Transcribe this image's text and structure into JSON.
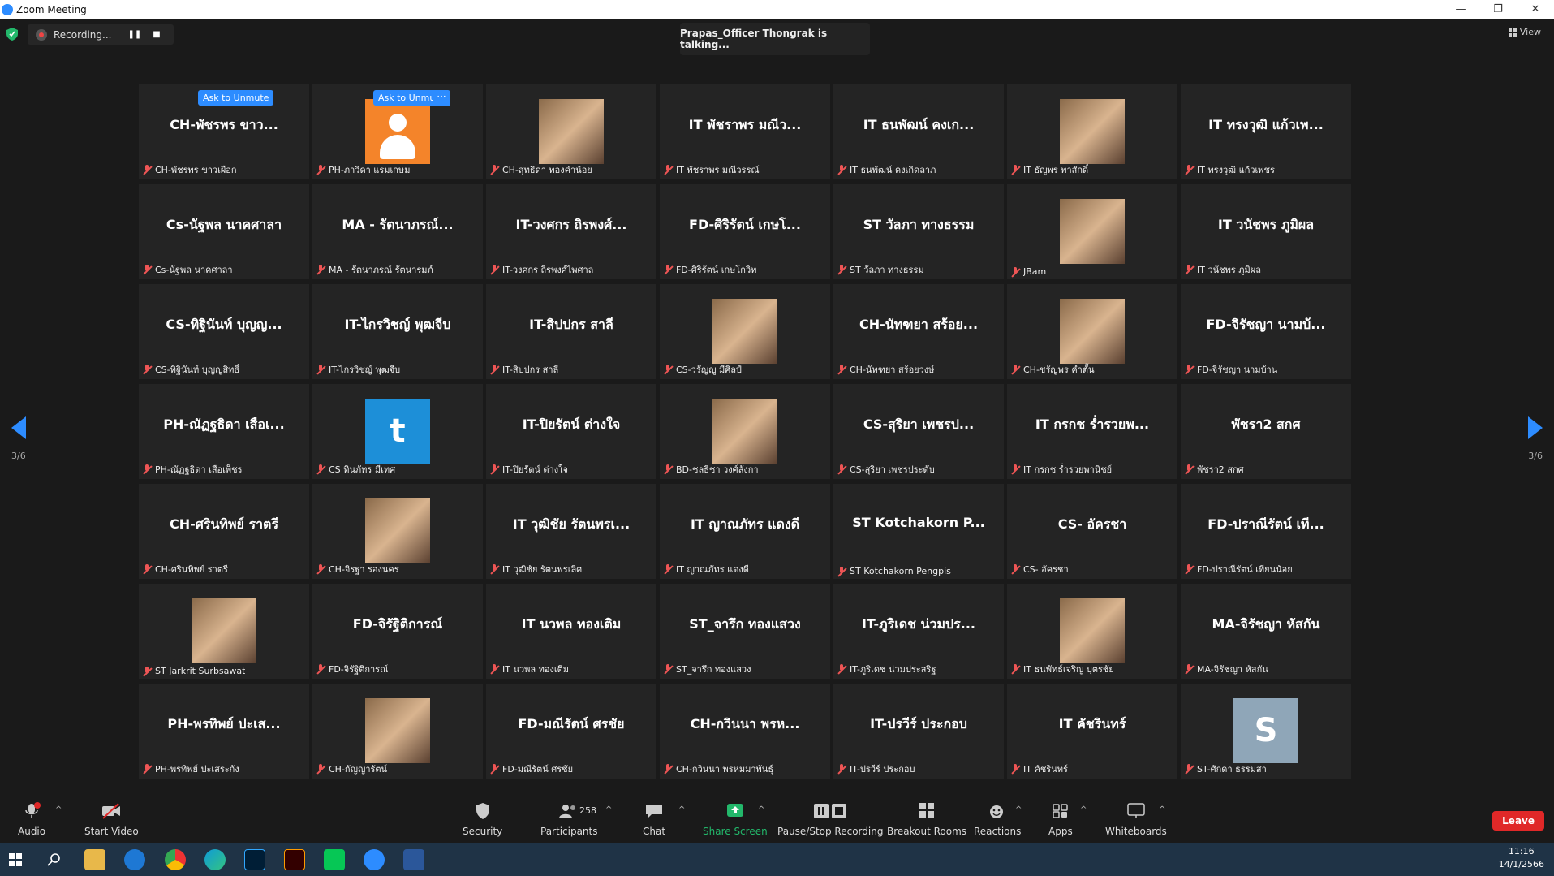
{
  "window": {
    "title": "Zoom Meeting",
    "minimize": "—",
    "restore": "❐",
    "close": "✕"
  },
  "topbar": {
    "recording_label": "Recording...",
    "talking_text": "Prapas_Officer Thongrak is talking...",
    "view_label": "View"
  },
  "pagination": {
    "left": "3/6",
    "right": "3/6"
  },
  "overlay": {
    "ask_to_unmute": "Ask to Unmute",
    "more": "···"
  },
  "participants": [
    {
      "big": "CH-พัชรพร ขาว...",
      "name": "CH-พัชรพร ขาวเผือก",
      "type": "name",
      "unmute": true
    },
    {
      "big": "",
      "name": "PH-ภาวิดา แรมเกษม",
      "type": "person",
      "unmute": true,
      "more": true
    },
    {
      "big": "",
      "name": "CH-สุทธิดา ทองคำน้อย",
      "type": "photo"
    },
    {
      "big": "IT พัชราพร มณีว...",
      "name": "IT พัชราพร มณีวรรณ์",
      "type": "name"
    },
    {
      "big": "IT ธนพัฒน์ คงเก...",
      "name": "IT ธนพัฒน์ คงเกิดลาภ",
      "type": "name"
    },
    {
      "big": "",
      "name": "IT ธัญพร พาสักดิ์",
      "type": "photo"
    },
    {
      "big": "IT ทรงวุฒิ แก้วเพ...",
      "name": "IT ทรงวุฒิ แก้วเพชร",
      "type": "name"
    },
    {
      "big": "Cs-นัฐพล นาคศาลา",
      "name": "Cs-นัฐพล นาคศาลา",
      "type": "name"
    },
    {
      "big": "MA - รัตนาภรณ์...",
      "name": "MA - รัตนาภรณ์ รัตนารมภ์",
      "type": "name"
    },
    {
      "big": "IT-วงศกร ถิรพงศ์...",
      "name": "IT-วงศกร ถิรพงศ์ไพศาล",
      "type": "name"
    },
    {
      "big": "FD-ศิริรัตน์ เกษโ...",
      "name": "FD-ศิริรัตน์ เกษโกวิท",
      "type": "name"
    },
    {
      "big": "ST วัลภา ทางธรรม",
      "name": "ST วัลภา ทางธรรม",
      "type": "name"
    },
    {
      "big": "",
      "name": "JBam",
      "type": "photo"
    },
    {
      "big": "IT วนัชพร ภูมิผล",
      "name": "IT วนัชพร ภูมิผล",
      "type": "name"
    },
    {
      "big": "CS-ทิฐินันท์ บุญญ...",
      "name": "CS-ทิฐินันท์ บุญญสิทธิ์",
      "type": "name"
    },
    {
      "big": "IT-ไกรวิชญ์ พุฒจีบ",
      "name": "IT-ไกรวิชญ์ พุฒจีบ",
      "type": "name"
    },
    {
      "big": "IT-สิปปกร สาลี",
      "name": "IT-สิปปกร สาลี",
      "type": "name"
    },
    {
      "big": "",
      "name": "CS-วรัญญู มีศิลป์",
      "type": "photo"
    },
    {
      "big": "CH-นัทฑยา สร้อย...",
      "name": "CH-นัทฑยา สร้อยวงษ์",
      "type": "name"
    },
    {
      "big": "",
      "name": "CH-ชรัญพร คำตั้น",
      "type": "photo"
    },
    {
      "big": "FD-จิรัชญา นามบ้...",
      "name": "FD-จิรัชญา นามบ้าน",
      "type": "name"
    },
    {
      "big": "PH-ณัฏฐธิดา เสือเ...",
      "name": "PH-ณัฏฐธิดา เสือเพ็ชร",
      "type": "name"
    },
    {
      "big": "",
      "name": "CS ทินภัทร มีเทศ",
      "type": "letter",
      "letter": "t",
      "color": "#1d8fd8"
    },
    {
      "big": "IT-ปิยรัตน์ ต่างใจ",
      "name": "IT-ปิยรัตน์ ต่างใจ",
      "type": "name"
    },
    {
      "big": "",
      "name": "BD-ชลธิชา วงศ์ลังกา",
      "type": "photo"
    },
    {
      "big": "CS-สุริยา เพชรป...",
      "name": "CS-สุริยา เพชรประดับ",
      "type": "name"
    },
    {
      "big": "IT กรกช ร่ำรวยพ...",
      "name": "IT กรกช ร่ำรวยพานิชย์",
      "type": "name"
    },
    {
      "big": "พัชรา2 สกศ",
      "name": "พัชรา2 สกศ",
      "type": "name"
    },
    {
      "big": "CH-ศรินทิพย์ ราตรี",
      "name": "CH-ศรินทิพย์ ราตรี",
      "type": "name"
    },
    {
      "big": "",
      "name": "CH-จิรฐา รองนคร",
      "type": "photo"
    },
    {
      "big": "IT วุฒิชัย รัตนพรเ...",
      "name": "IT วุฒิชัย รัตนพรเลิศ",
      "type": "name"
    },
    {
      "big": "IT ญาณภัทร แดงดี",
      "name": "IT ญาณภัทร แดงดี",
      "type": "name"
    },
    {
      "big": "ST Kotchakorn P...",
      "name": "ST Kotchakorn Pengpis",
      "type": "name"
    },
    {
      "big": "CS- อัครชา",
      "name": "CS- อัครชา",
      "type": "name"
    },
    {
      "big": "FD-ปราณีรัตน์ เที...",
      "name": "FD-ปราณีรัตน์ เทียนน้อย",
      "type": "name"
    },
    {
      "big": "",
      "name": "ST Jarkrit Surbsawat",
      "type": "photo"
    },
    {
      "big": "FD-จิรัฐิติการณ์",
      "name": "FD-จิรัฐิติการณ์",
      "type": "name"
    },
    {
      "big": "IT นวพล ทองเติม",
      "name": "IT นวพล ทองเติม",
      "type": "name"
    },
    {
      "big": "ST_จารึก ทองแสวง",
      "name": "ST_จารึก ทองแสวง",
      "type": "name"
    },
    {
      "big": "IT-ภูริเดช น่วมปร...",
      "name": "IT-ภูริเดช น่วมประสริฐ",
      "type": "name"
    },
    {
      "big": "",
      "name": "IT ธนพัทธ์เจริญ บุตรชัย",
      "type": "photo"
    },
    {
      "big": "MA-จิรัชญา หัสกัน",
      "name": "MA-จิรัชญา หัสกัน",
      "type": "name"
    },
    {
      "big": "PH-พรทิพย์ ปะเส...",
      "name": "PH-พรทิพย์ ปะเสระกัง",
      "type": "name"
    },
    {
      "big": "",
      "name": "CH-กัญญารัตน์",
      "type": "photo"
    },
    {
      "big": "FD-มณีรัตน์ ศรชัย",
      "name": "FD-มณีรัตน์ ศรชัย",
      "type": "name"
    },
    {
      "big": "CH-กวินนา พรห...",
      "name": "CH-กวินนา พรหมมาพันธุ์",
      "type": "name"
    },
    {
      "big": "IT-ปรวีร์ ประกอบ",
      "name": "IT-ปรวีร์ ประกอบ",
      "type": "name"
    },
    {
      "big": "IT คัชรินทร์",
      "name": "IT คัชรินทร์",
      "type": "name"
    },
    {
      "big": "",
      "name": "ST-ศักดา ธรรมสา",
      "type": "letter",
      "letter": "S",
      "color": "#8fa6b8"
    }
  ],
  "toolbar": {
    "audio": "Audio",
    "start_video": "Start Video",
    "security": "Security",
    "participants": "Participants",
    "participants_count": "258",
    "chat": "Chat",
    "share_screen": "Share Screen",
    "pause_recording": "Pause/Stop Recording",
    "breakout": "Breakout Rooms",
    "reactions": "Reactions",
    "apps": "Apps",
    "whiteboards": "Whiteboards",
    "leave": "Leave",
    "caret": "^"
  },
  "taskbar": {
    "time": "11:16",
    "date": "14/1/2566"
  },
  "colors": {
    "accent": "#2d8cff",
    "leave": "#e02828",
    "share": "#23b86b",
    "muted": "#e55555"
  }
}
